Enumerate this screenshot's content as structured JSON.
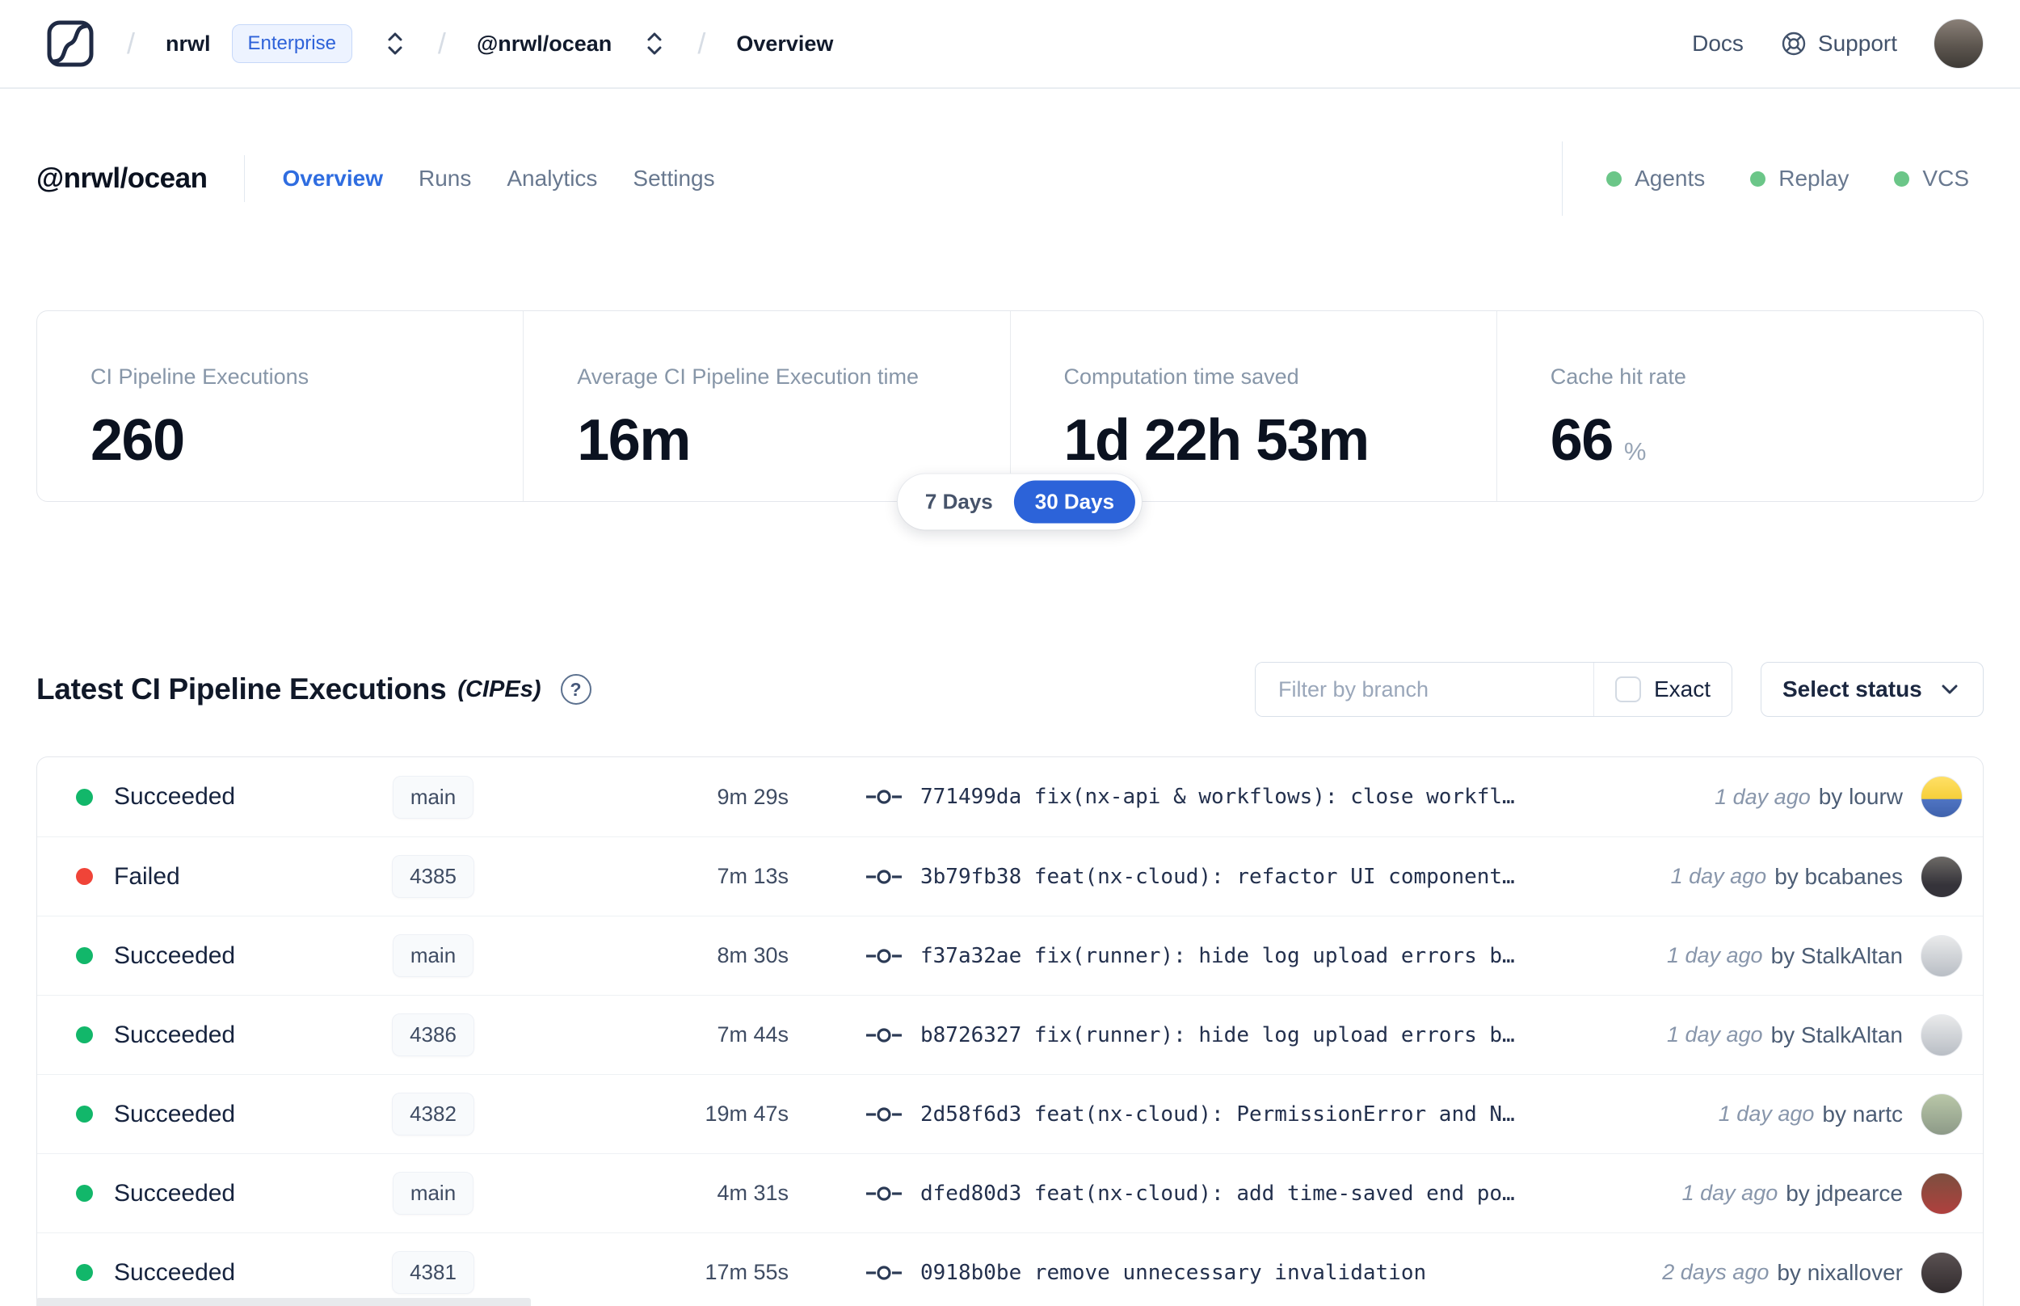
{
  "navbar": {
    "breadcrumb": {
      "org": "nrwl",
      "org_badge": "Enterprise",
      "workspace": "@nrwl/ocean",
      "page": "Overview"
    },
    "docs_label": "Docs",
    "support_label": "Support",
    "avatar_color": "linear-gradient(180deg,#8a8078 0%,#5d564f 55%,#3e3a36 100%)"
  },
  "workspace_header": {
    "title": "@nrwl/ocean",
    "tabs": [
      {
        "label": "Overview"
      },
      {
        "label": "Runs"
      },
      {
        "label": "Analytics"
      },
      {
        "label": "Settings"
      }
    ],
    "indicators": [
      {
        "label": "Agents",
        "color": "#6bc688"
      },
      {
        "label": "Replay",
        "color": "#6bc688"
      },
      {
        "label": "VCS",
        "color": "#6bc688"
      }
    ]
  },
  "stats": {
    "cards": [
      {
        "label": "CI Pipeline Executions",
        "value": "260",
        "suffix": ""
      },
      {
        "label": "Average CI Pipeline Execution time",
        "value": "16m",
        "suffix": ""
      },
      {
        "label": "Computation time saved",
        "value": "1d 22h 53m",
        "suffix": ""
      },
      {
        "label": "Cache hit rate",
        "value": "66",
        "suffix": "%"
      }
    ],
    "range_toggle": {
      "options": [
        {
          "label": "7 Days"
        },
        {
          "label": "30 Days"
        }
      ],
      "selected": "30 Days"
    }
  },
  "cipe_section": {
    "title": "Latest CI Pipeline Executions",
    "title_suffix": "(CIPEs)",
    "help_icon": "?",
    "filter": {
      "placeholder": "Filter by branch",
      "exact_label": "Exact",
      "status_label": "Select status"
    },
    "rows": [
      {
        "status": "Succeeded",
        "dot_color": "#12b76a",
        "branch": "main",
        "duration": "9m 29s",
        "commit": "771499da fix(nx-api & workflows): close workfl…",
        "time": "1 day ago",
        "author": "by lourw",
        "avatar_color": "linear-gradient(180deg,#ffe066 0%,#f6cf3a 55%,#4f74c2 56%,#3f62ad 100%)"
      },
      {
        "status": "Failed",
        "dot_color": "#f04438",
        "branch": "4385",
        "duration": "7m 13s",
        "commit": "3b79fb38 feat(nx-cloud): refactor UI component…",
        "time": "1 day ago",
        "author": "by bcabanes",
        "avatar_color": "linear-gradient(180deg,#6d6a66 0%,#35333a 70%)"
      },
      {
        "status": "Succeeded",
        "dot_color": "#12b76a",
        "branch": "main",
        "duration": "8m 30s",
        "commit": "f37a32ae fix(runner): hide log upload errors b…",
        "time": "1 day ago",
        "author": "by StalkAltan",
        "avatar_color": "linear-gradient(180deg,#e9eaeb 0%,#b9bec5 100%)"
      },
      {
        "status": "Succeeded",
        "dot_color": "#12b76a",
        "branch": "4386",
        "duration": "7m 44s",
        "commit": "b8726327 fix(runner): hide log upload errors b…",
        "time": "1 day ago",
        "author": "by StalkAltan",
        "avatar_color": "linear-gradient(180deg,#e9eaeb 0%,#b9bec5 100%)"
      },
      {
        "status": "Succeeded",
        "dot_color": "#12b76a",
        "branch": "4382",
        "duration": "19m 47s",
        "commit": "2d58f6d3 feat(nx-cloud): PermissionError and N…",
        "time": "1 day ago",
        "author": "by nartc",
        "avatar_color": "linear-gradient(180deg,#b9c7a8 0%,#8d9a88 100%)"
      },
      {
        "status": "Succeeded",
        "dot_color": "#12b76a",
        "branch": "main",
        "duration": "4m 31s",
        "commit": "dfed80d3 feat(nx-cloud): add time-saved end po…",
        "time": "1 day ago",
        "author": "by jdpearce",
        "avatar_color": "linear-gradient(180deg,#7c4f3f 0%,#b0403e 100%)"
      },
      {
        "status": "Succeeded",
        "dot_color": "#12b76a",
        "branch": "4381",
        "duration": "17m 55s",
        "commit": "0918b0be remove unnecessary invalidation",
        "time": "2 days ago",
        "author": "by nixallover",
        "avatar_color": "linear-gradient(180deg,#5a5152 0%,#322c2e 100%)"
      }
    ]
  }
}
